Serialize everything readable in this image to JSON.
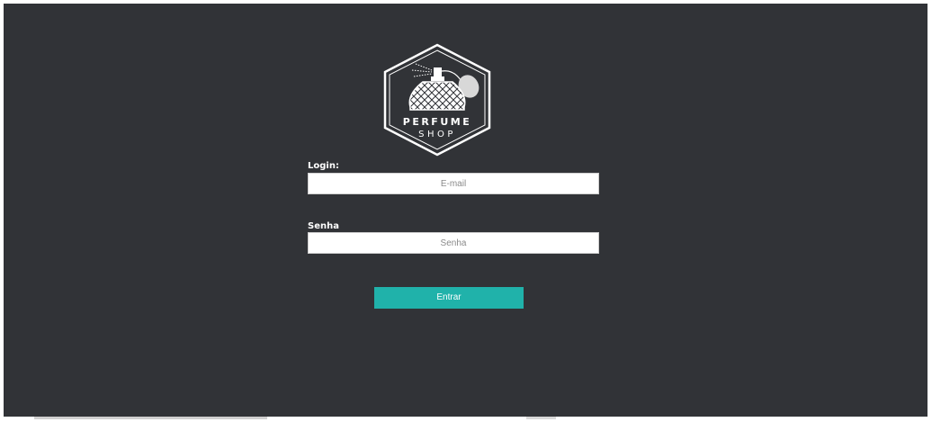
{
  "logo": {
    "brand_top": "PERFUME",
    "brand_bottom": "SHOP",
    "icon": "perfume-bottle-icon"
  },
  "form": {
    "login_label": "Login:",
    "email_placeholder": "E-mail",
    "email_value": "",
    "senha_label": "Senha",
    "senha_placeholder": "Senha",
    "senha_value": "",
    "submit_label": "Entrar"
  },
  "colors": {
    "background": "#313337",
    "accent": "#20b2aa",
    "label_text": "#ffffff"
  }
}
